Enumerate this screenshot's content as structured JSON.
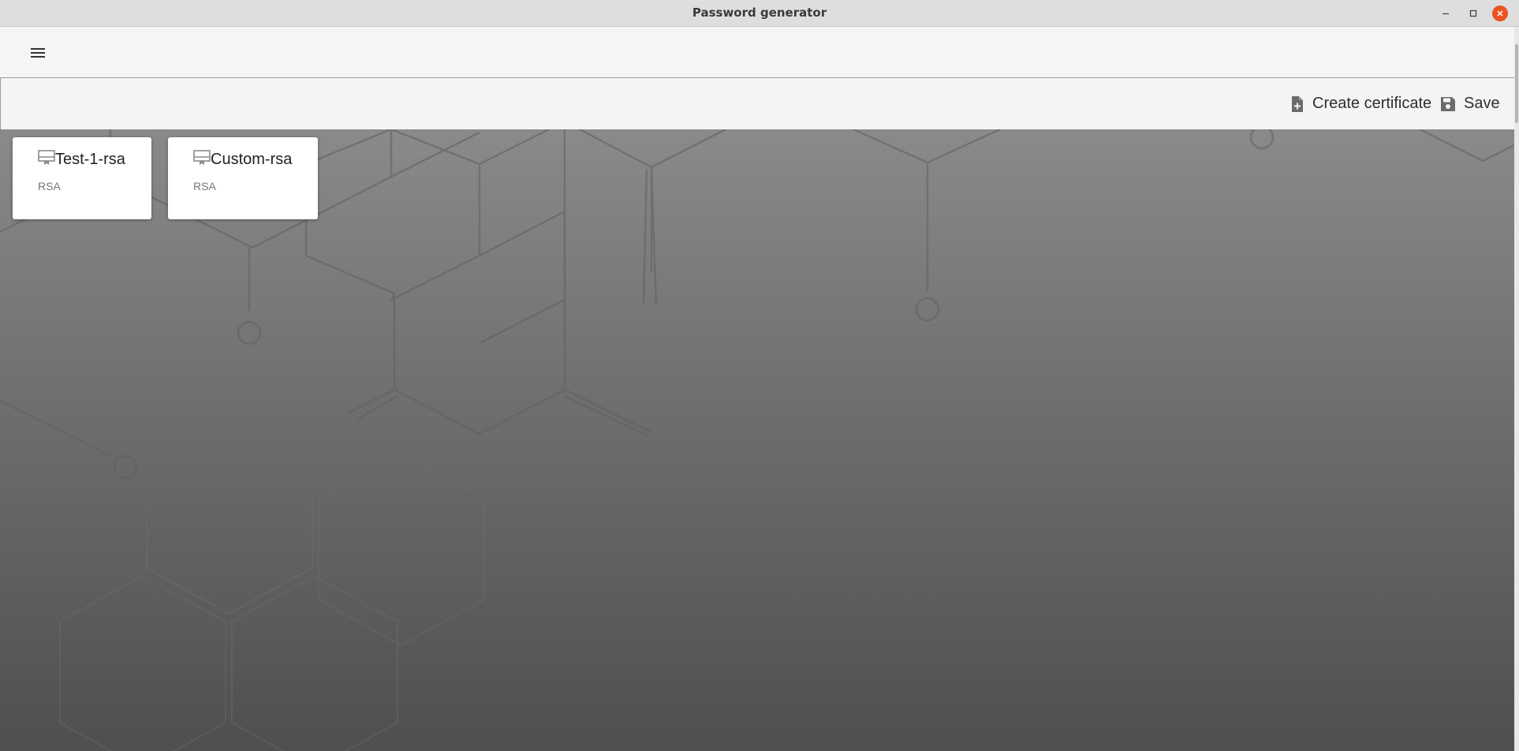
{
  "window": {
    "title": "Password generator"
  },
  "appbar": {
    "menu_icon": "hamburger-menu-icon"
  },
  "toolbar": {
    "create_certificate_label": "Create certificate",
    "create_certificate_icon": "file-plus-icon",
    "save_label": "Save",
    "save_icon": "floppy-disk-icon"
  },
  "certificates": [
    {
      "name": "Test-1-rsa",
      "type": "RSA",
      "icon": "certificate-icon"
    },
    {
      "name": "Custom-rsa",
      "type": "RSA",
      "icon": "certificate-icon"
    }
  ],
  "colors": {
    "close_button": "#e95420",
    "appbar_bg": "#f5f5f5",
    "content_top": "#8a8a8a",
    "content_bottom": "#4f4f4f"
  }
}
